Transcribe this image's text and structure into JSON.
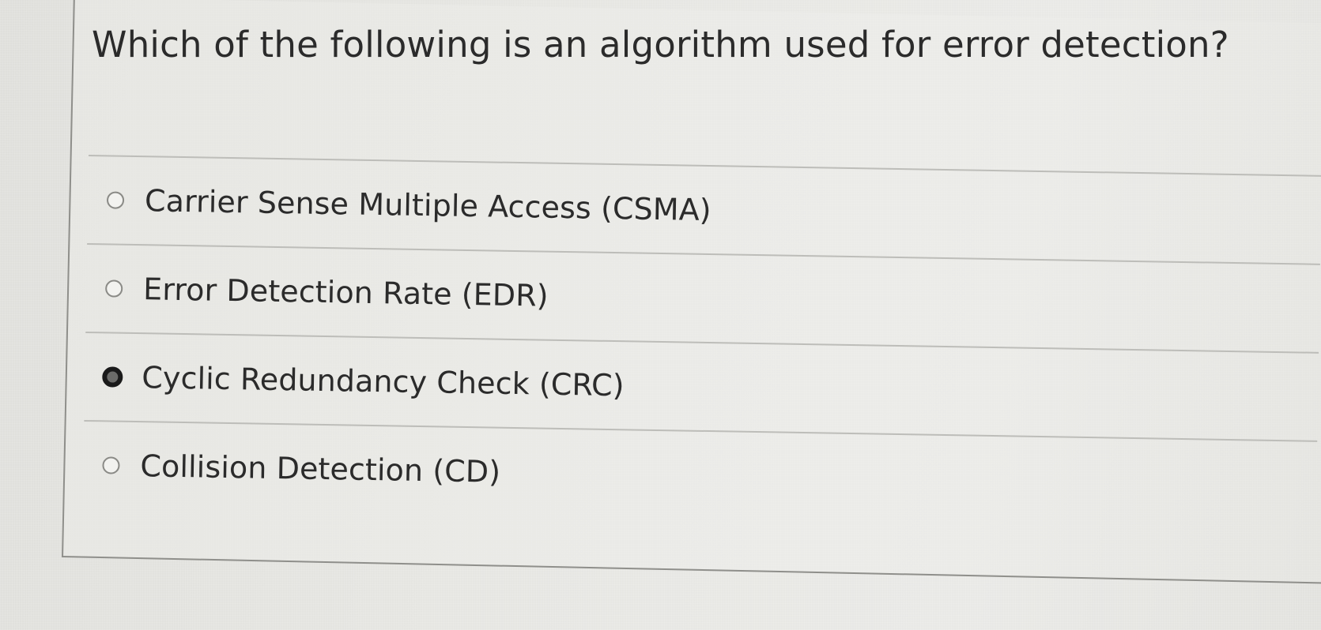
{
  "question": {
    "text": "Which of the following is an algorithm used for error detection?"
  },
  "options": [
    {
      "label": "Carrier Sense Multiple Access (CSMA)",
      "selected": false
    },
    {
      "label": "Error Detection Rate (EDR)",
      "selected": false
    },
    {
      "label": "Cyclic Redundancy Check (CRC)",
      "selected": true
    },
    {
      "label": "Collision Detection (CD)",
      "selected": false
    }
  ]
}
